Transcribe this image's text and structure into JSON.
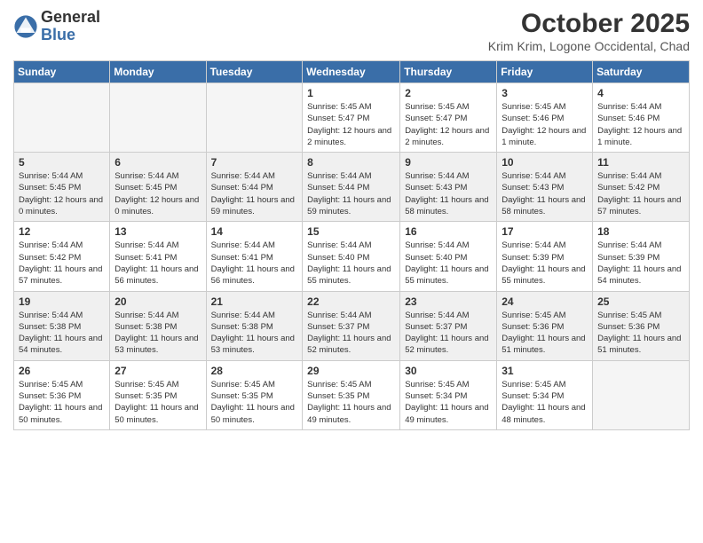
{
  "header": {
    "logo_general": "General",
    "logo_blue": "Blue",
    "month_year": "October 2025",
    "location": "Krim Krim, Logone Occidental, Chad"
  },
  "days_of_week": [
    "Sunday",
    "Monday",
    "Tuesday",
    "Wednesday",
    "Thursday",
    "Friday",
    "Saturday"
  ],
  "weeks": [
    [
      {
        "day": "",
        "info": ""
      },
      {
        "day": "",
        "info": ""
      },
      {
        "day": "",
        "info": ""
      },
      {
        "day": "1",
        "info": "Sunrise: 5:45 AM\nSunset: 5:47 PM\nDaylight: 12 hours and 2 minutes."
      },
      {
        "day": "2",
        "info": "Sunrise: 5:45 AM\nSunset: 5:47 PM\nDaylight: 12 hours and 2 minutes."
      },
      {
        "day": "3",
        "info": "Sunrise: 5:45 AM\nSunset: 5:46 PM\nDaylight: 12 hours and 1 minute."
      },
      {
        "day": "4",
        "info": "Sunrise: 5:44 AM\nSunset: 5:46 PM\nDaylight: 12 hours and 1 minute."
      }
    ],
    [
      {
        "day": "5",
        "info": "Sunrise: 5:44 AM\nSunset: 5:45 PM\nDaylight: 12 hours and 0 minutes."
      },
      {
        "day": "6",
        "info": "Sunrise: 5:44 AM\nSunset: 5:45 PM\nDaylight: 12 hours and 0 minutes."
      },
      {
        "day": "7",
        "info": "Sunrise: 5:44 AM\nSunset: 5:44 PM\nDaylight: 11 hours and 59 minutes."
      },
      {
        "day": "8",
        "info": "Sunrise: 5:44 AM\nSunset: 5:44 PM\nDaylight: 11 hours and 59 minutes."
      },
      {
        "day": "9",
        "info": "Sunrise: 5:44 AM\nSunset: 5:43 PM\nDaylight: 11 hours and 58 minutes."
      },
      {
        "day": "10",
        "info": "Sunrise: 5:44 AM\nSunset: 5:43 PM\nDaylight: 11 hours and 58 minutes."
      },
      {
        "day": "11",
        "info": "Sunrise: 5:44 AM\nSunset: 5:42 PM\nDaylight: 11 hours and 57 minutes."
      }
    ],
    [
      {
        "day": "12",
        "info": "Sunrise: 5:44 AM\nSunset: 5:42 PM\nDaylight: 11 hours and 57 minutes."
      },
      {
        "day": "13",
        "info": "Sunrise: 5:44 AM\nSunset: 5:41 PM\nDaylight: 11 hours and 56 minutes."
      },
      {
        "day": "14",
        "info": "Sunrise: 5:44 AM\nSunset: 5:41 PM\nDaylight: 11 hours and 56 minutes."
      },
      {
        "day": "15",
        "info": "Sunrise: 5:44 AM\nSunset: 5:40 PM\nDaylight: 11 hours and 55 minutes."
      },
      {
        "day": "16",
        "info": "Sunrise: 5:44 AM\nSunset: 5:40 PM\nDaylight: 11 hours and 55 minutes."
      },
      {
        "day": "17",
        "info": "Sunrise: 5:44 AM\nSunset: 5:39 PM\nDaylight: 11 hours and 55 minutes."
      },
      {
        "day": "18",
        "info": "Sunrise: 5:44 AM\nSunset: 5:39 PM\nDaylight: 11 hours and 54 minutes."
      }
    ],
    [
      {
        "day": "19",
        "info": "Sunrise: 5:44 AM\nSunset: 5:38 PM\nDaylight: 11 hours and 54 minutes."
      },
      {
        "day": "20",
        "info": "Sunrise: 5:44 AM\nSunset: 5:38 PM\nDaylight: 11 hours and 53 minutes."
      },
      {
        "day": "21",
        "info": "Sunrise: 5:44 AM\nSunset: 5:38 PM\nDaylight: 11 hours and 53 minutes."
      },
      {
        "day": "22",
        "info": "Sunrise: 5:44 AM\nSunset: 5:37 PM\nDaylight: 11 hours and 52 minutes."
      },
      {
        "day": "23",
        "info": "Sunrise: 5:44 AM\nSunset: 5:37 PM\nDaylight: 11 hours and 52 minutes."
      },
      {
        "day": "24",
        "info": "Sunrise: 5:45 AM\nSunset: 5:36 PM\nDaylight: 11 hours and 51 minutes."
      },
      {
        "day": "25",
        "info": "Sunrise: 5:45 AM\nSunset: 5:36 PM\nDaylight: 11 hours and 51 minutes."
      }
    ],
    [
      {
        "day": "26",
        "info": "Sunrise: 5:45 AM\nSunset: 5:36 PM\nDaylight: 11 hours and 50 minutes."
      },
      {
        "day": "27",
        "info": "Sunrise: 5:45 AM\nSunset: 5:35 PM\nDaylight: 11 hours and 50 minutes."
      },
      {
        "day": "28",
        "info": "Sunrise: 5:45 AM\nSunset: 5:35 PM\nDaylight: 11 hours and 50 minutes."
      },
      {
        "day": "29",
        "info": "Sunrise: 5:45 AM\nSunset: 5:35 PM\nDaylight: 11 hours and 49 minutes."
      },
      {
        "day": "30",
        "info": "Sunrise: 5:45 AM\nSunset: 5:34 PM\nDaylight: 11 hours and 49 minutes."
      },
      {
        "day": "31",
        "info": "Sunrise: 5:45 AM\nSunset: 5:34 PM\nDaylight: 11 hours and 48 minutes."
      },
      {
        "day": "",
        "info": ""
      }
    ]
  ]
}
